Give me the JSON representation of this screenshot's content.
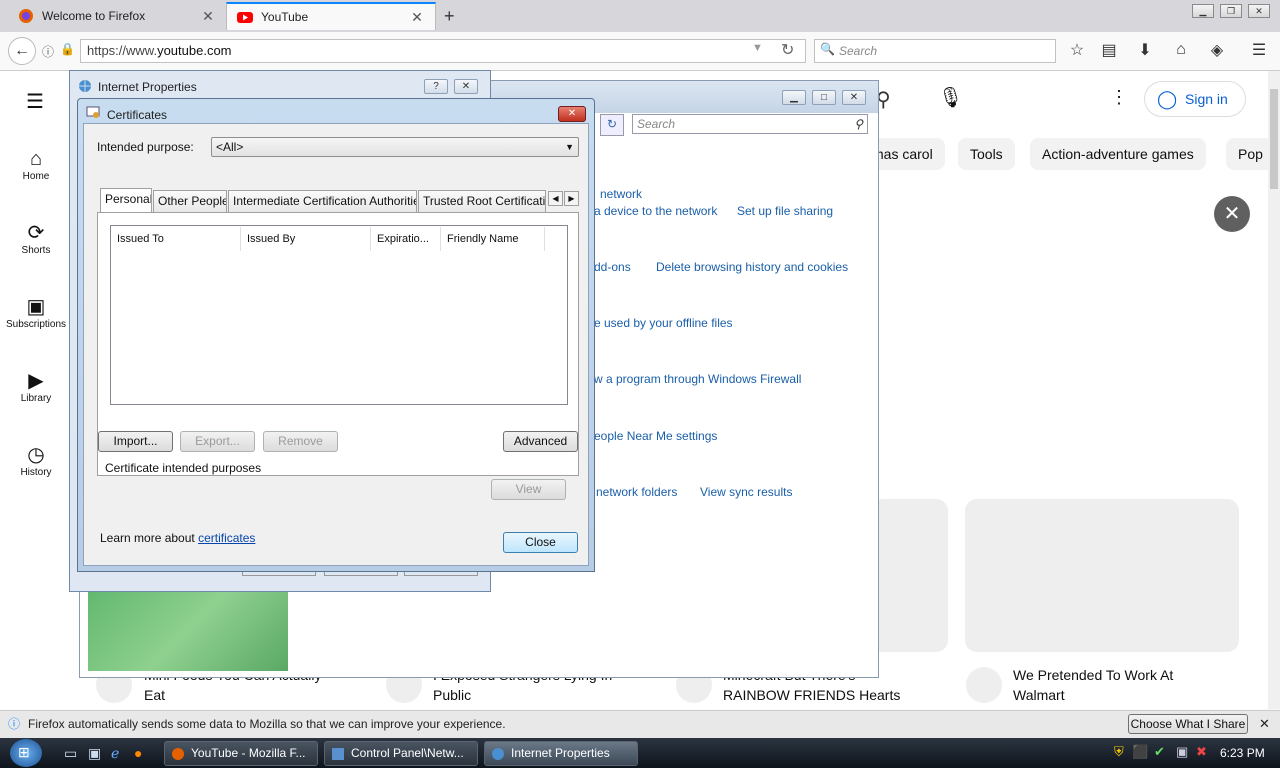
{
  "browser": {
    "tabs": [
      {
        "title": "Welcome to Firefox",
        "active": false
      },
      {
        "title": "YouTube",
        "active": true
      }
    ],
    "url_prefix": "https://www.",
    "url_host": "youtube.com",
    "search_placeholder": "Search",
    "notification": "Firefox automatically sends some data to Mozilla so that we can improve your experience.",
    "notification_button": "Choose What I Share"
  },
  "youtube": {
    "sidebar": [
      {
        "label": "Home",
        "icon": "home-icon"
      },
      {
        "label": "Shorts",
        "icon": "shorts-icon"
      },
      {
        "label": "Subscriptions",
        "icon": "subscriptions-icon"
      },
      {
        "label": "Library",
        "icon": "library-icon"
      },
      {
        "label": "History",
        "icon": "history-icon"
      }
    ],
    "sign_in": "Sign in",
    "chips": [
      "mas carol",
      "Tools",
      "Action-adventure games",
      "Pop"
    ],
    "videos": [
      {
        "title_line1": "Mini Foods You Can Actually",
        "title_line2": "Eat"
      },
      {
        "title_line1": "I Exposed Strangers Lying In",
        "title_line2": "Public"
      },
      {
        "title_line1": "Minecraft But There's",
        "title_line2": "RAINBOW FRIENDS Hearts"
      },
      {
        "title_line1": "We Pretended To Work At",
        "title_line2": "Walmart"
      }
    ]
  },
  "control_panel": {
    "search_placeholder": "Search",
    "links": [
      {
        "text": "network"
      },
      {
        "text": "a device to the network"
      },
      {
        "text": "Set up file sharing"
      },
      {
        "text": "dd-ons"
      },
      {
        "text": "Delete browsing history and cookies"
      },
      {
        "text": "e used by your offline files"
      },
      {
        "text": "w a program through Windows Firewall"
      },
      {
        "text": "eople Near Me settings"
      },
      {
        "text": "network folders"
      },
      {
        "text": "View sync results"
      }
    ]
  },
  "internet_properties": {
    "title": "Internet Properties",
    "help": "?",
    "close": "✕"
  },
  "certificates": {
    "title": "Certificates",
    "intended_purpose_label": "Intended purpose:",
    "intended_purpose_value": "<All>",
    "tabs": [
      "Personal",
      "Other People",
      "Intermediate Certification Authorities",
      "Trusted Root Certification"
    ],
    "columns": [
      "Issued To",
      "Issued By",
      "Expiratio...",
      "Friendly Name"
    ],
    "buttons": {
      "import": "Import...",
      "export": "Export...",
      "remove": "Remove",
      "advanced": "Advanced",
      "view": "View",
      "close": "Close"
    },
    "purposes_label": "Certificate intended purposes",
    "learn_more": "Learn more about",
    "learn_more_link": "certificates"
  },
  "taskbar": {
    "items": [
      {
        "label": "YouTube - Mozilla F..."
      },
      {
        "label": "Control Panel\\Netw..."
      },
      {
        "label": "Internet Properties"
      }
    ],
    "time": "6:23 PM"
  }
}
